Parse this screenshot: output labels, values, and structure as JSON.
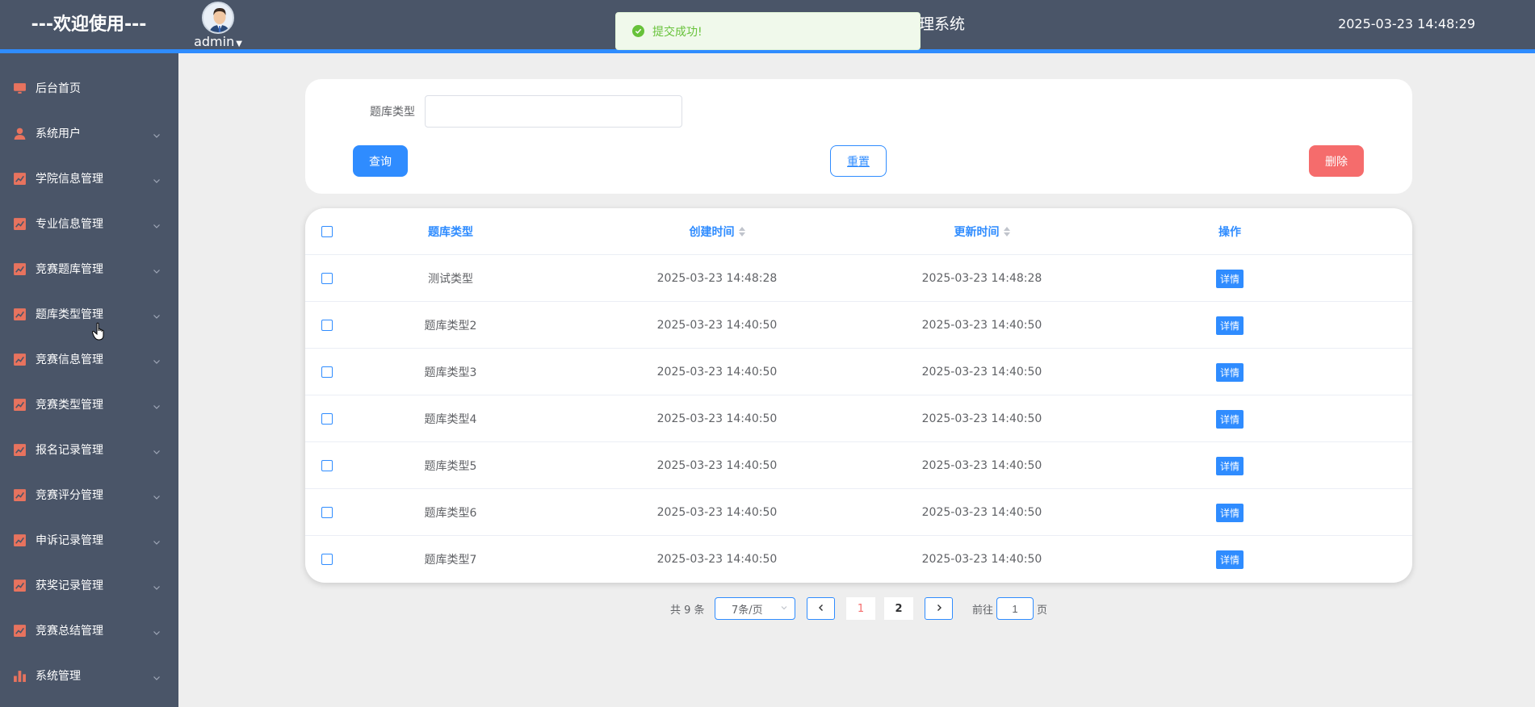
{
  "header": {
    "welcome": "---欢迎使用---",
    "username": "admin",
    "system_title_visible": "理系统",
    "datetime": "2025-03-23 14:48:29"
  },
  "toast": {
    "message": "提交成功!"
  },
  "sidebar": {
    "items": [
      {
        "label": "后台首页",
        "icon": "monitor-icon",
        "has_arrow": false
      },
      {
        "label": "系统用户",
        "icon": "user-icon",
        "has_arrow": true
      },
      {
        "label": "学院信息管理",
        "icon": "chart-line-icon",
        "has_arrow": true
      },
      {
        "label": "专业信息管理",
        "icon": "chart-line-icon",
        "has_arrow": true
      },
      {
        "label": "竞赛题库管理",
        "icon": "chart-line-icon",
        "has_arrow": true
      },
      {
        "label": "题库类型管理",
        "icon": "chart-line-icon",
        "has_arrow": true
      },
      {
        "label": "竞赛信息管理",
        "icon": "chart-line-icon",
        "has_arrow": true
      },
      {
        "label": "竞赛类型管理",
        "icon": "chart-line-icon",
        "has_arrow": true
      },
      {
        "label": "报名记录管理",
        "icon": "chart-line-icon",
        "has_arrow": true
      },
      {
        "label": "竞赛评分管理",
        "icon": "chart-line-icon",
        "has_arrow": true
      },
      {
        "label": "申诉记录管理",
        "icon": "chart-line-icon",
        "has_arrow": true
      },
      {
        "label": "获奖记录管理",
        "icon": "chart-line-icon",
        "has_arrow": true
      },
      {
        "label": "竞赛总结管理",
        "icon": "chart-line-icon",
        "has_arrow": true
      },
      {
        "label": "系统管理",
        "icon": "bar-chart-icon",
        "has_arrow": true
      }
    ]
  },
  "search": {
    "label": "题库类型",
    "value": "",
    "query_label": "查询",
    "reset_label": "重置",
    "delete_label": "删除"
  },
  "table": {
    "columns": [
      "题库类型",
      "创建时间",
      "更新时间",
      "操作"
    ],
    "detail_label": "详情",
    "rows": [
      {
        "type": "测试类型",
        "created": "2025-03-23 14:48:28",
        "updated": "2025-03-23 14:48:28"
      },
      {
        "type": "题库类型2",
        "created": "2025-03-23 14:40:50",
        "updated": "2025-03-23 14:40:50"
      },
      {
        "type": "题库类型3",
        "created": "2025-03-23 14:40:50",
        "updated": "2025-03-23 14:40:50"
      },
      {
        "type": "题库类型4",
        "created": "2025-03-23 14:40:50",
        "updated": "2025-03-23 14:40:50"
      },
      {
        "type": "题库类型5",
        "created": "2025-03-23 14:40:50",
        "updated": "2025-03-23 14:40:50"
      },
      {
        "type": "题库类型6",
        "created": "2025-03-23 14:40:50",
        "updated": "2025-03-23 14:40:50"
      },
      {
        "type": "题库类型7",
        "created": "2025-03-23 14:40:50",
        "updated": "2025-03-23 14:40:50"
      }
    ]
  },
  "pagination": {
    "total": "共 9 条",
    "page_size": "7条/页",
    "pages": [
      "1",
      "2"
    ],
    "current_page": "1",
    "goto_prefix": "前往",
    "goto_value": "1",
    "goto_suffix": "页"
  },
  "colors": {
    "header_bg": "#4a5568",
    "accent": "#2f8cff",
    "danger": "#f56c6c",
    "success": "#67c23a",
    "sidebar_icon": "#e8735e"
  }
}
